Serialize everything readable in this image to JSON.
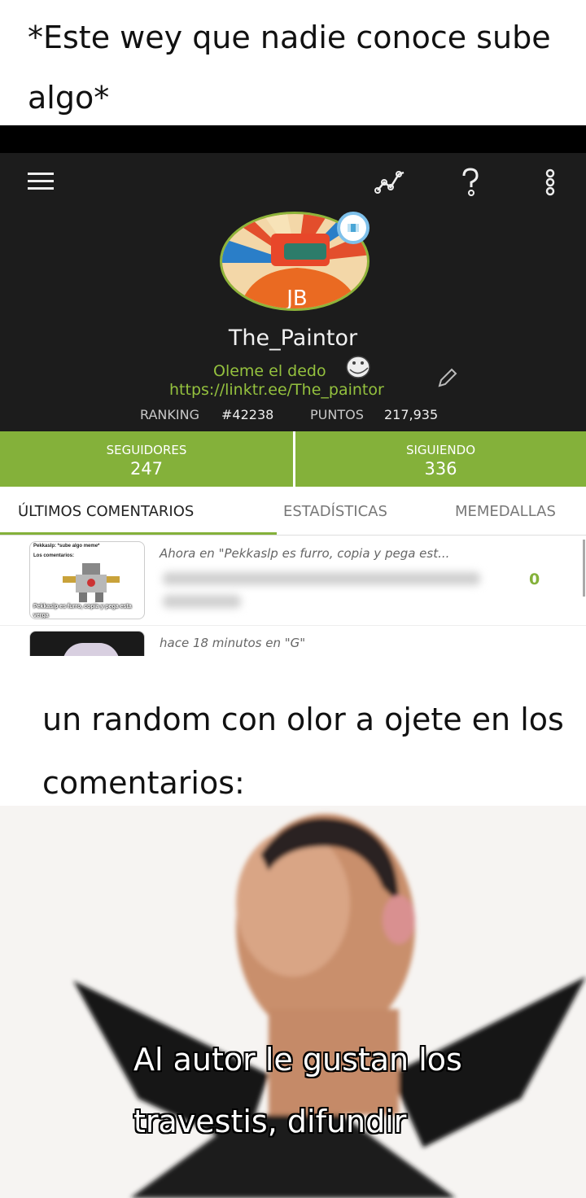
{
  "caption_top": {
    "line1": "*Este wey que nadie conoce sube",
    "line2": "algo*"
  },
  "profile": {
    "username": "The_Paintor",
    "bio_line1": "Oleme el dedo",
    "bio_line2": "https://linktr.ee/The_paintor",
    "ranking_label": "RANKING",
    "ranking_value": "#42238",
    "points_label": "PUNTOS",
    "points_value": "217,935"
  },
  "followers": {
    "label": "SEGUIDORES",
    "value": "247"
  },
  "following": {
    "label": "SIGUIENDO",
    "value": "336"
  },
  "tabs": [
    {
      "label": "ÚLTIMOS COMENTARIOS"
    },
    {
      "label": "ESTADÍSTICAS"
    },
    {
      "label": "MEMEDALLAS"
    }
  ],
  "comments": [
    {
      "text": "Ahora en \"Pekkaslp es furro, copia y pega est...",
      "count": "0",
      "thumb_title": "Pekkaslp: *sube algo meme*",
      "thumb_sub": "Los comentarios:",
      "thumb_caption": "Pekkaslp es furro, copia y pega esta verga"
    },
    {
      "text": "hace 18 minutos en \"G\""
    }
  ],
  "caption_mid": {
    "line1": "un random con olor a ojete en los",
    "line2": "comentarios:"
  },
  "meme_subtitle": {
    "line1": "Al autor le gustan los",
    "line2": "travestis, difundir"
  },
  "colors": {
    "accent": "#84b13a",
    "profile_bg": "#1c1c1c",
    "bio_text": "#94c13e"
  },
  "icons": [
    "menu-icon",
    "stats-chart-icon",
    "help-icon",
    "more-vertical-icon",
    "edit-pencil-icon",
    "trollface-icon",
    "flag-badge-icon"
  ]
}
